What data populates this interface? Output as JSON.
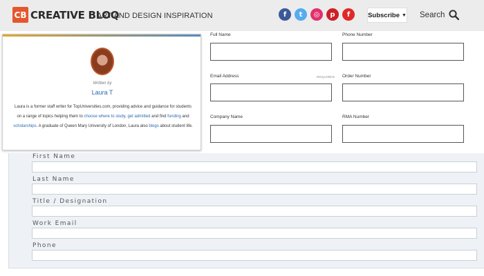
{
  "header": {
    "logo_mark": "CB",
    "logo_text": "CREATIVE BLOQ",
    "tagline": "ART AND DESIGN INSPIRATION",
    "social": [
      {
        "name": "facebook-icon",
        "glyph": "f",
        "color": "#3b5998"
      },
      {
        "name": "twitter-icon",
        "glyph": "t",
        "color": "#55acee"
      },
      {
        "name": "instagram-icon",
        "glyph": "◎",
        "color": "#e1306c"
      },
      {
        "name": "pinterest-icon",
        "glyph": "p",
        "color": "#cb2027"
      },
      {
        "name": "flipboard-icon",
        "glyph": "f",
        "color": "#e12828"
      }
    ],
    "subscribe_label": "Subscribe",
    "subscribe_caret": "▼",
    "search_label": "Search"
  },
  "author": {
    "written_by": "Written by",
    "name": "Laura T",
    "bio_1": "Laura is a former staff writer for TopUniversities.com, providing advice and guidance for students on a range of topics helping them to ",
    "link_1": "choose where to study",
    "bio_2": ", ",
    "link_2": "get admitted",
    "bio_3": " and find ",
    "link_3": "funding",
    "bio_4": " and ",
    "link_4": "scholarships",
    "bio_5": ". A graduate of Queen Mary University of London, Laura also ",
    "link_5": "blogs",
    "bio_6": " about student life."
  },
  "form_top": {
    "full_name": "Full Name",
    "phone_number": "Phone Number",
    "email_address": "Email Address",
    "required": "REQUIRED",
    "order_number": "Order Number",
    "company_name": "Company Name",
    "rma_number": "RMA Number"
  },
  "form_lower": {
    "first_name": "First Name",
    "last_name": "Last Name",
    "title_designation": "Title / Designation",
    "work_email": "Work Email",
    "phone": "Phone"
  }
}
